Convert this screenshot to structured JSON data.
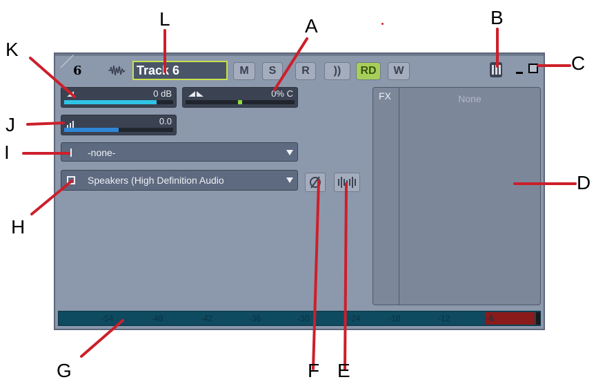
{
  "track": {
    "number": "6",
    "name": "Track 6",
    "buttons": [
      "M",
      "S",
      "R",
      "))",
      "RD",
      "W"
    ]
  },
  "faders": {
    "volume_label": "0 dB",
    "volume_level": 0.85,
    "pan_label": "0% C",
    "pan_position": 0.5,
    "trim_label": "0.0",
    "trim_level": 0.5
  },
  "input": {
    "value": "-none-"
  },
  "output": {
    "value": "Speakers (High Definition Audio"
  },
  "fx": {
    "header": "FX",
    "empty_label": "None"
  },
  "meter": {
    "ticks": [
      "-54",
      "-48",
      "-42",
      "-36",
      "-30",
      "-24",
      "-18",
      "-12",
      "-6"
    ]
  },
  "callouts": [
    "A",
    "B",
    "C",
    "D",
    "E",
    "F",
    "G",
    "H",
    "I",
    "J",
    "K",
    "L"
  ],
  "colors": {
    "accent_line": "#cc1f2a",
    "rd_active": "#a6cf5a",
    "volume_fill": "#2fc4e6"
  },
  "icons": [
    "waveform-icon",
    "envelope-icon",
    "minimize-icon",
    "restore-icon",
    "phase-icon",
    "width-icon",
    "input-icon",
    "output-icon"
  ]
}
